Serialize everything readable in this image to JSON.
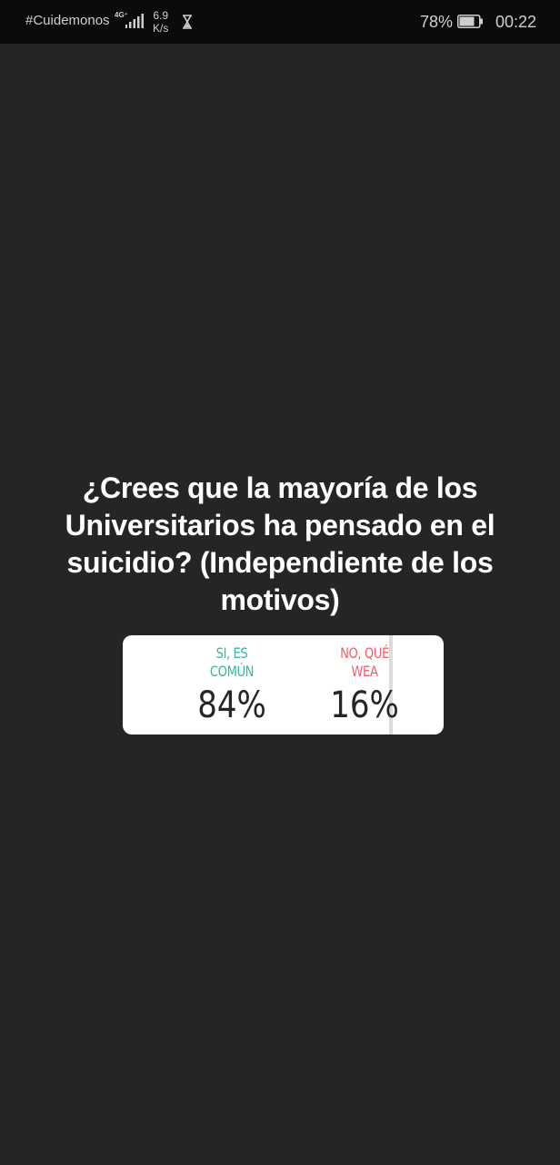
{
  "status_bar": {
    "carrier": "#Cuidemonos",
    "network": "4G⁺",
    "speed_value": "6.9",
    "speed_unit": "K/s",
    "battery_percent": "78%",
    "time": "00:22"
  },
  "poll": {
    "question": "¿Crees que la mayoría de los Universitarios ha pensado en el suicidio? (Independiente de los motivos)",
    "options": [
      {
        "label_line1": "SI, ES",
        "label_line2": "COMÚN",
        "percent": "84%",
        "color": "#36b79a"
      },
      {
        "label_line1": "NO, QUÉ",
        "label_line2": "WEA",
        "percent": "16%",
        "color": "#ef5f6a"
      }
    ]
  }
}
